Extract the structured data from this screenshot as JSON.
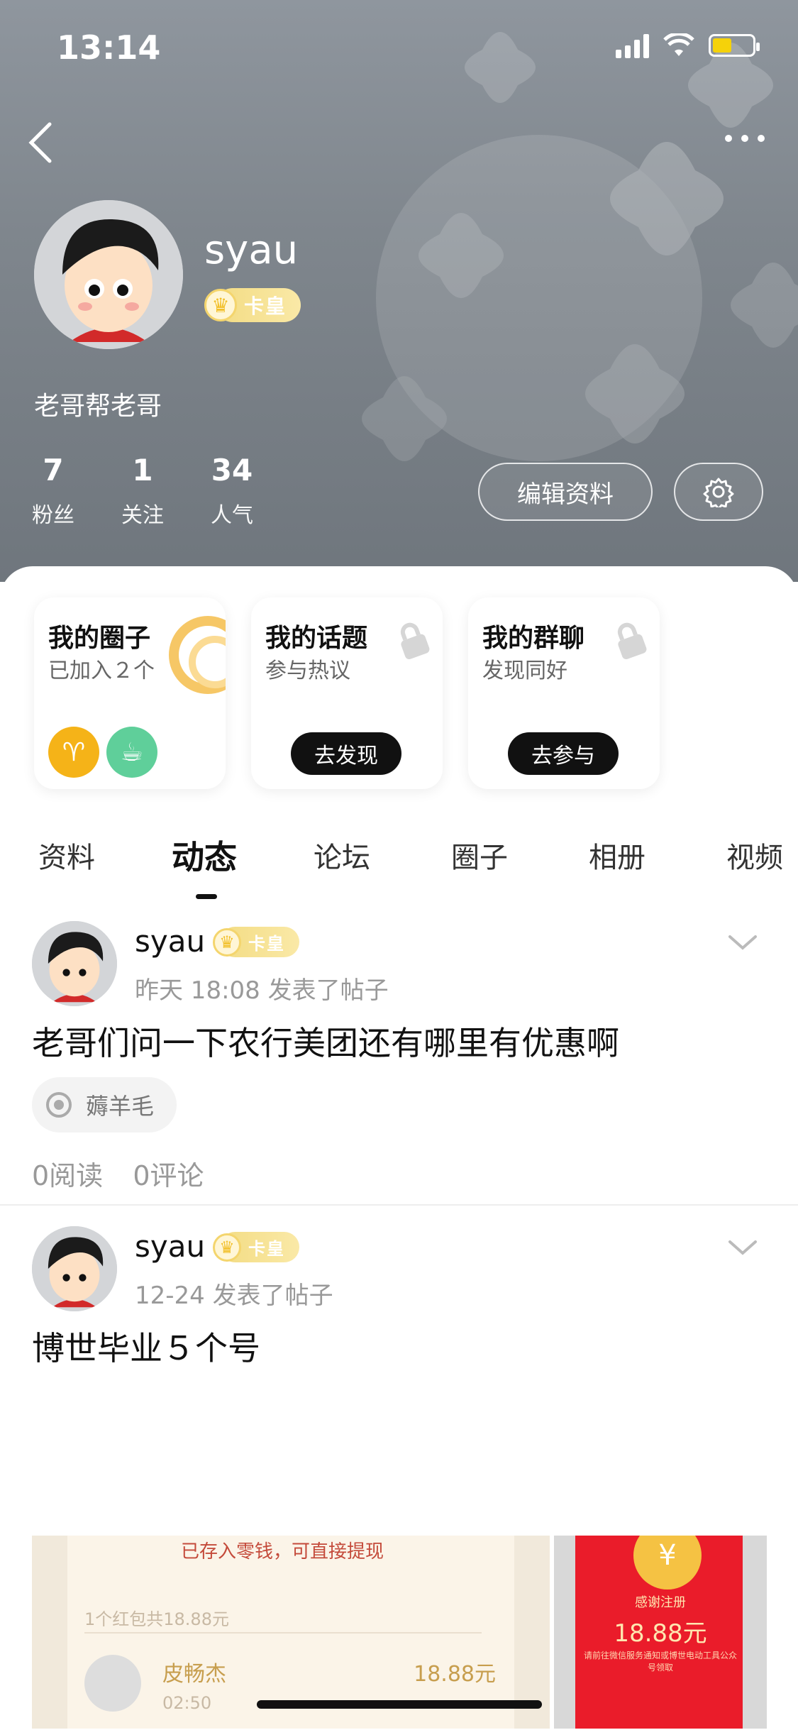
{
  "status": {
    "time": "13:14"
  },
  "profile": {
    "username": "syau",
    "vip_label": "卡皇",
    "bio": "老哥帮老哥",
    "stats": [
      {
        "value": "7",
        "label": "粉丝"
      },
      {
        "value": "1",
        "label": "关注"
      },
      {
        "value": "34",
        "label": "人气"
      }
    ],
    "edit_label": "编辑资料"
  },
  "cards": [
    {
      "title": "我的圈子",
      "subtitle": "已加入２个"
    },
    {
      "title": "我的话题",
      "subtitle": "参与热议",
      "button": "去发现"
    },
    {
      "title": "我的群聊",
      "subtitle": "发现同好",
      "button": "去参与"
    }
  ],
  "tabs": [
    "资料",
    "动态",
    "论坛",
    "圈子",
    "相册",
    "视频"
  ],
  "posts": [
    {
      "author": "syau",
      "vip_label": "卡皇",
      "meta": "昨天 18:08 发表了帖子",
      "text": "老哥们问一下农行美团还有哪里有优惠啊",
      "topic": "薅羊毛",
      "reads": "0阅读",
      "comments": "0评论"
    },
    {
      "author": "syau",
      "vip_label": "卡皇",
      "meta": "12-24 发表了帖子",
      "text": "博世毕业５个号"
    }
  ],
  "image_left": {
    "line1": "已存入零钱，可直接提现",
    "line2": "1个红包共18.88元",
    "name": "皮畅杰",
    "amount": "18.88元",
    "time": "02:50"
  },
  "image_right": {
    "line1": "感谢注册",
    "amount": "18.88元",
    "line3": "请前往微信服务通知或博世电动工具公众号领取",
    "symbol": "¥"
  },
  "colors": {
    "accent": "#111111",
    "vip": "#f3dc83",
    "red_packet": "#ea1c2a"
  }
}
